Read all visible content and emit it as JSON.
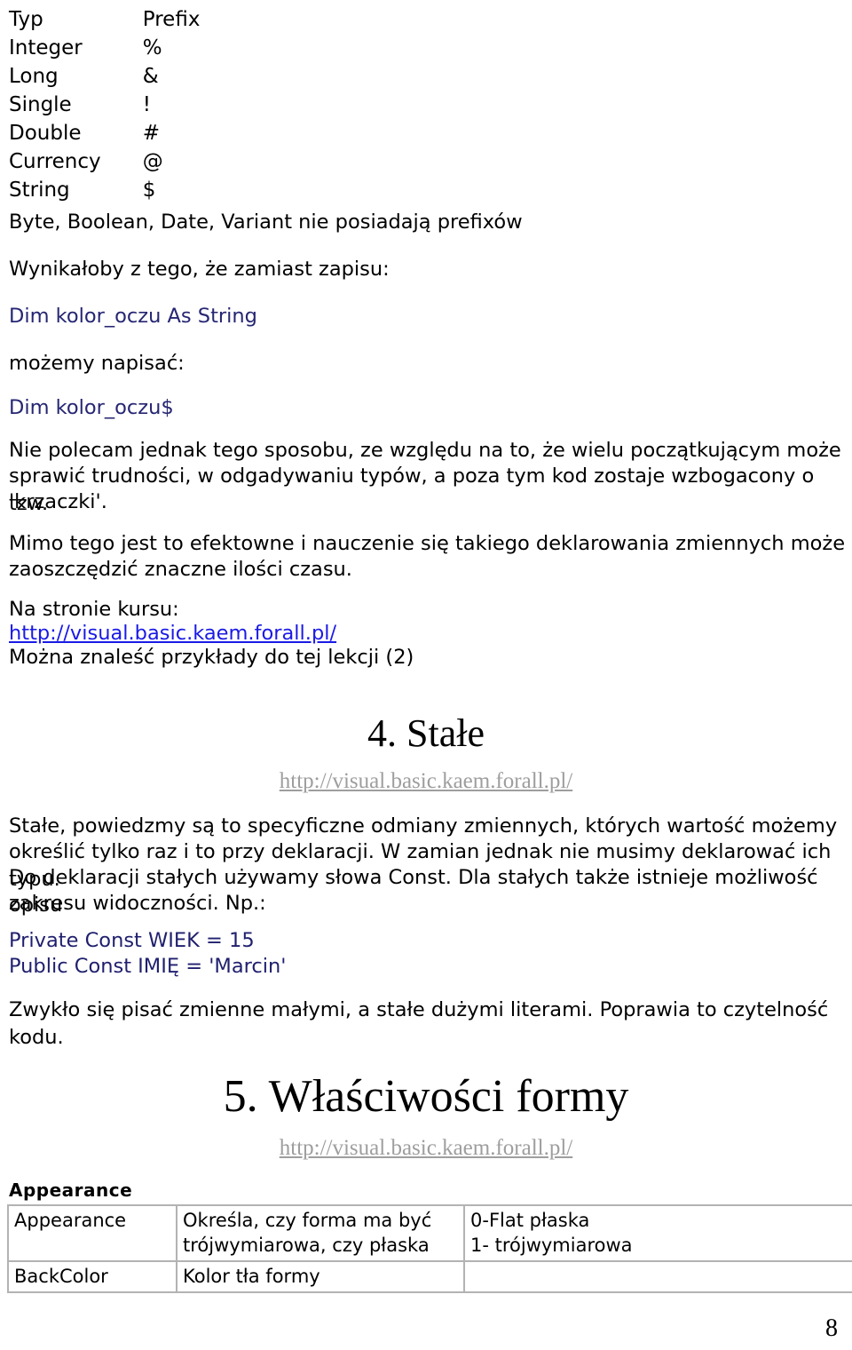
{
  "type_table": {
    "rows": [
      {
        "typ": "Typ",
        "prefix": "Prefix"
      },
      {
        "typ": "Integer",
        "prefix": "%"
      },
      {
        "typ": "Long",
        "prefix": "&"
      },
      {
        "typ": "Single",
        "prefix": "!"
      },
      {
        "typ": "Double",
        "prefix": "#"
      },
      {
        "typ": "Currency",
        "prefix": "@"
      },
      {
        "typ": "String",
        "prefix": "$"
      }
    ]
  },
  "body": {
    "no_prefix_note": "Byte, Boolean, Date, Variant nie posiadają prefixów",
    "instead_of": "Wynikałoby z tego, że zamiast zapisu:",
    "code_dim_long": "Dim kolor_oczu As String",
    "we_can_write": "możemy napisać:",
    "code_dim_short": "Dim kolor_oczu$",
    "warning_line1": "Nie polecam jednak tego sposobu, ze względu na to, że wielu początkującym może",
    "warning_line2": "sprawić trudności, w odgadywaniu typów, a poza tym kod zostaje wzbogacony o tzw.",
    "warning_line3": "'krzaczki'.",
    "benefit_line1": "Mimo tego jest to efektowne i nauczenie się takiego deklarowania zmiennych może",
    "benefit_line2": "zaoszczędzić znaczne ilości czasu.",
    "course_page_label": "Na stronie kursu:",
    "course_url": "http://visual.basic.kaem.forall.pl/",
    "examples_line": "Można znaleść przykłady do tej lekcji (2)"
  },
  "section4": {
    "heading": "4. Stałe",
    "url": "http://visual.basic.kaem.forall.pl/",
    "para_line1": "Stałe, powiedzmy są to specyficzne odmiany zmiennych, których wartość możemy",
    "para_line2": "określić tylko raz i to przy deklaracji. W zamian jednak nie musimy deklarować ich typu.",
    "para_line3": "Do deklaracji stałych używamy słowa Const. Dla stałych także istnieje możliwość opisu",
    "para_line4": "zakresu widoczności. Np.:",
    "code_line1": "Private Const WIEK = 15",
    "code_line2": "Public Const IMIĘ = 'Marcin'",
    "closing_line": "Zwykło się pisać zmienne małymi, a stałe dużymi literami. Poprawia to czytelność kodu."
  },
  "section5": {
    "heading": "5. Właściwości formy",
    "url": "http://visual.basic.kaem.forall.pl/",
    "table_title": "Appearance",
    "rows": [
      {
        "name": "Appearance",
        "description": "Określa, czy forma ma być\ntrójwymiarowa, czy płaska",
        "values": "0-Flat płaska\n1- trójwymiarowa"
      },
      {
        "name": "BackColor",
        "description": "Kolor tła formy",
        "values": ""
      }
    ]
  },
  "footer": {
    "page_number": "8"
  },
  "colors": {
    "code_navy": "#262673",
    "link_blue": "#1a1ae6",
    "link_grey": "#9e9e9e",
    "table_border": "#b3b3b3"
  }
}
